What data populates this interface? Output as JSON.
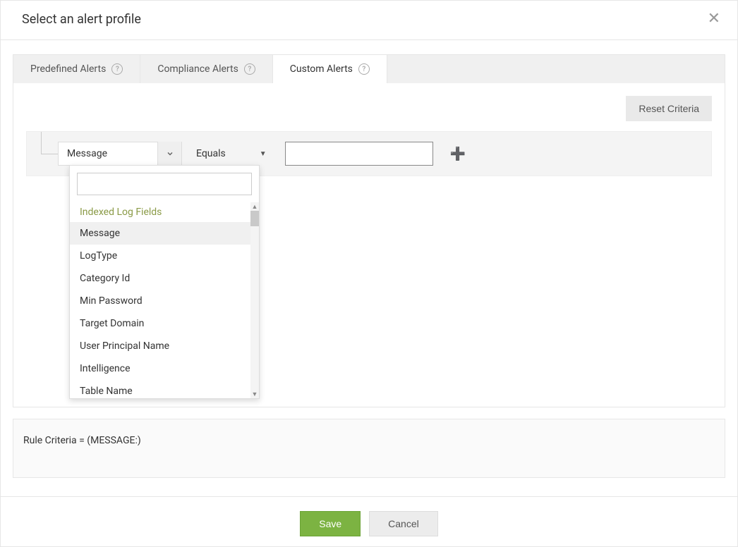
{
  "header": {
    "title": "Select an alert profile"
  },
  "tabs": {
    "predefined": "Predefined Alerts",
    "compliance": "Compliance Alerts",
    "custom": "Custom Alerts"
  },
  "actions": {
    "reset": "Reset Criteria",
    "save": "Save",
    "cancel": "Cancel"
  },
  "criteria": {
    "field": "Message",
    "operator": "Equals",
    "value": ""
  },
  "dropdown": {
    "search": "",
    "group": "Indexed Log Fields",
    "options": [
      "Message",
      "LogType",
      "Category Id",
      "Min Password",
      "Target Domain",
      "User Principal Name",
      "Intelligence",
      "Table Name"
    ]
  },
  "summary": {
    "text": "Rule Criteria = (MESSAGE:)"
  }
}
